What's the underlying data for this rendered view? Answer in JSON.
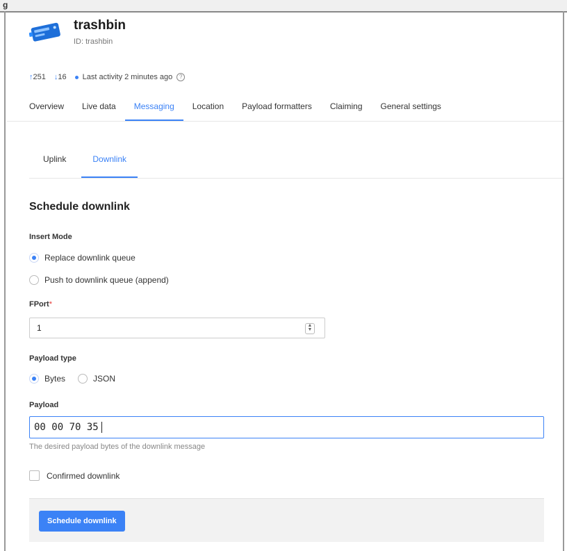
{
  "window": {
    "caption": "g"
  },
  "device": {
    "name": "trashbin",
    "id_label": "ID: trashbin",
    "uplink_count": "251",
    "downlink_count": "16",
    "last_activity": "Last activity 2 minutes ago",
    "status_color": "#3b82f6"
  },
  "main_tabs": [
    {
      "label": "Overview"
    },
    {
      "label": "Live data"
    },
    {
      "label": "Messaging"
    },
    {
      "label": "Location"
    },
    {
      "label": "Payload formatters"
    },
    {
      "label": "Claiming"
    },
    {
      "label": "General settings"
    }
  ],
  "active_main_tab": "Messaging",
  "sub_tabs": [
    {
      "label": "Uplink"
    },
    {
      "label": "Downlink"
    }
  ],
  "active_sub_tab": "Downlink",
  "form": {
    "title": "Schedule downlink",
    "insert_mode_label": "Insert Mode",
    "insert_mode_options": [
      {
        "label": "Replace downlink queue",
        "checked": true
      },
      {
        "label": "Push to downlink queue (append)",
        "checked": false
      }
    ],
    "fport_label": "FPort",
    "fport_required_mark": "*",
    "fport_value": "1",
    "payload_type_label": "Payload type",
    "payload_type_options": [
      {
        "label": "Bytes",
        "checked": true
      },
      {
        "label": "JSON",
        "checked": false
      }
    ],
    "payload_label": "Payload",
    "payload_value": "00 00 70 35",
    "payload_hint": "The desired payload bytes of the downlink message",
    "confirmed_label": "Confirmed downlink",
    "confirmed_checked": false,
    "submit_label": "Schedule downlink"
  },
  "colors": {
    "accent": "#3b82f6",
    "required": "#e53935"
  }
}
